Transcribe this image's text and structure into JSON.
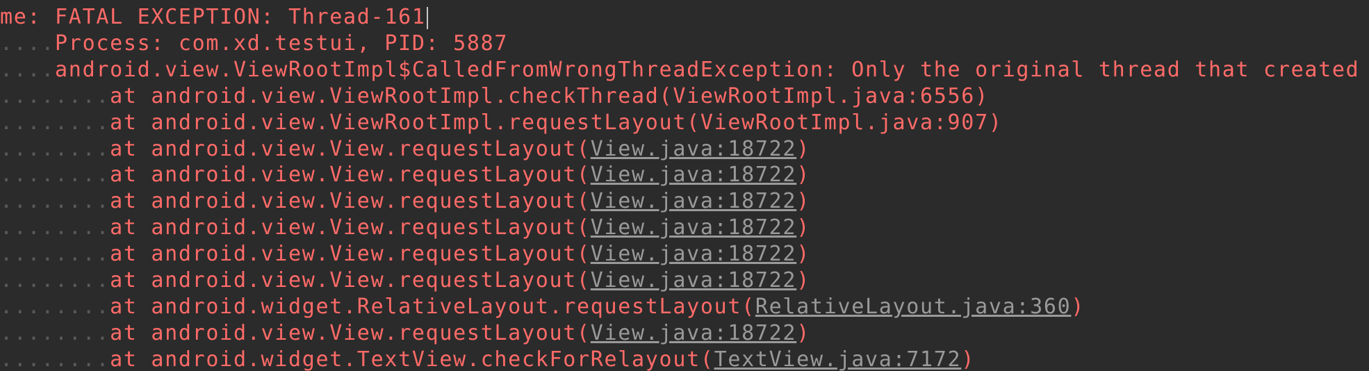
{
  "theme": {
    "background": "#2b2b2b",
    "error_text": "#ff6b68",
    "link_text": "#9a9a9a"
  },
  "lines": [
    {
      "indent": "",
      "text": "me: FATAL EXCEPTION: Thread-161",
      "link": "",
      "close": "",
      "cursor": true
    },
    {
      "indent": "....",
      "text": "Process: com.xd.testui, PID: 5887",
      "link": "",
      "close": ""
    },
    {
      "indent": "....",
      "text": "android.view.ViewRootImpl$CalledFromWrongThreadException: Only the original thread that created",
      "link": "",
      "close": ""
    },
    {
      "indent": "........",
      "text": "at android.view.ViewRootImpl.checkThread(ViewRootImpl.java:6556)",
      "link": "",
      "close": ""
    },
    {
      "indent": "........",
      "text": "at android.view.ViewRootImpl.requestLayout(ViewRootImpl.java:907)",
      "link": "",
      "close": ""
    },
    {
      "indent": "........",
      "text": "at android.view.View.requestLayout(",
      "link": "View.java:18722",
      "close": ")"
    },
    {
      "indent": "........",
      "text": "at android.view.View.requestLayout(",
      "link": "View.java:18722",
      "close": ")"
    },
    {
      "indent": "........",
      "text": "at android.view.View.requestLayout(",
      "link": "View.java:18722",
      "close": ")"
    },
    {
      "indent": "........",
      "text": "at android.view.View.requestLayout(",
      "link": "View.java:18722",
      "close": ")"
    },
    {
      "indent": "........",
      "text": "at android.view.View.requestLayout(",
      "link": "View.java:18722",
      "close": ")"
    },
    {
      "indent": "........",
      "text": "at android.view.View.requestLayout(",
      "link": "View.java:18722",
      "close": ")"
    },
    {
      "indent": "........",
      "text": "at android.widget.RelativeLayout.requestLayout(",
      "link": "RelativeLayout.java:360",
      "close": ")"
    },
    {
      "indent": "........",
      "text": "at android.view.View.requestLayout(",
      "link": "View.java:18722",
      "close": ")"
    },
    {
      "indent": "........",
      "text": "at android.widget.TextView.checkForRelayout(",
      "link": "TextView.java:7172",
      "close": ")"
    }
  ]
}
